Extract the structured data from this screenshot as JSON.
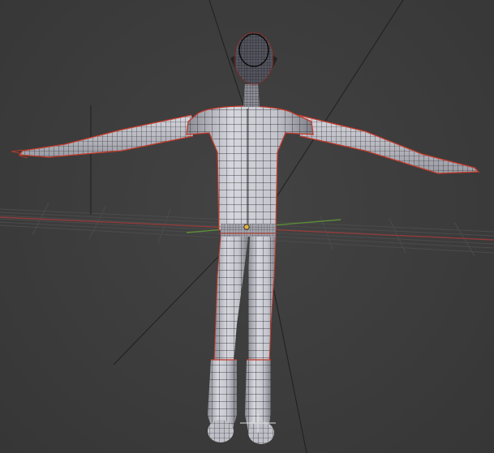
{
  "viewport": {
    "editor": "3D Viewport",
    "shading_mode": "solid-wireframe",
    "background_color": "#3c3c3c",
    "grid_color": "#4a4a4a",
    "x_axis_color": "#9b3c3c",
    "y_axis_color": "#6a9b3c",
    "mesh_surface_color": "#c9c9d2",
    "wire_color": "#151515",
    "selected_edge_color": "#d23a2a",
    "origin_marker_color": "#e2b040"
  },
  "scene": {
    "object_kind": "humanoid-character-mesh",
    "pose": "t-pose"
  }
}
